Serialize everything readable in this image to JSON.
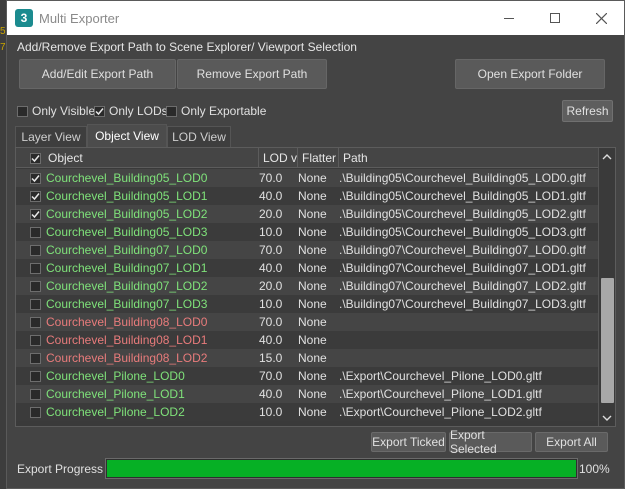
{
  "window": {
    "title": "Multi Exporter",
    "app_icon_text": "3",
    "controls": [
      "minimize-icon",
      "maximize-icon",
      "close-icon"
    ]
  },
  "section_label": "Add/Remove Export Path to Scene Explorer/ Viewport Selection",
  "buttons": {
    "add_edit": "Add/Edit Export Path",
    "remove": "Remove Export Path",
    "open_folder": "Open Export Folder"
  },
  "filters": {
    "only_visible": {
      "label": "Only Visible",
      "checked": false
    },
    "only_lods": {
      "label": "Only LODs",
      "checked": true
    },
    "only_exportable": {
      "label": "Only Exportable",
      "checked": false
    },
    "refresh": "Refresh"
  },
  "tabs": [
    {
      "label": "Layer View",
      "active": false
    },
    {
      "label": "Object View",
      "active": true
    },
    {
      "label": "LOD View",
      "active": false
    }
  ],
  "table": {
    "header_checked": true,
    "columns": {
      "object": "Object",
      "lod": "LOD va",
      "flatten": "Flatter",
      "path": "Path"
    },
    "rows": [
      {
        "checked": true,
        "name": "Courchevel_Building05_LOD0",
        "lod": "70.0",
        "flatten": "None",
        "path": ".\\Building05\\Courchevel_Building05_LOD0.gltf",
        "status": "ok"
      },
      {
        "checked": true,
        "name": "Courchevel_Building05_LOD1",
        "lod": "40.0",
        "flatten": "None",
        "path": ".\\Building05\\Courchevel_Building05_LOD1.gltf",
        "status": "ok"
      },
      {
        "checked": true,
        "name": "Courchevel_Building05_LOD2",
        "lod": "20.0",
        "flatten": "None",
        "path": ".\\Building05\\Courchevel_Building05_LOD2.gltf",
        "status": "ok"
      },
      {
        "checked": false,
        "name": "Courchevel_Building05_LOD3",
        "lod": "10.0",
        "flatten": "None",
        "path": ".\\Building05\\Courchevel_Building05_LOD3.gltf",
        "status": "ok"
      },
      {
        "checked": false,
        "name": "Courchevel_Building07_LOD0",
        "lod": "70.0",
        "flatten": "None",
        "path": ".\\Building07\\Courchevel_Building07_LOD0.gltf",
        "status": "ok"
      },
      {
        "checked": false,
        "name": "Courchevel_Building07_LOD1",
        "lod": "40.0",
        "flatten": "None",
        "path": ".\\Building07\\Courchevel_Building07_LOD1.gltf",
        "status": "ok"
      },
      {
        "checked": false,
        "name": "Courchevel_Building07_LOD2",
        "lod": "20.0",
        "flatten": "None",
        "path": ".\\Building07\\Courchevel_Building07_LOD2.gltf",
        "status": "ok"
      },
      {
        "checked": false,
        "name": "Courchevel_Building07_LOD3",
        "lod": "10.0",
        "flatten": "None",
        "path": ".\\Building07\\Courchevel_Building07_LOD3.gltf",
        "status": "ok"
      },
      {
        "checked": false,
        "name": "Courchevel_Building08_LOD0",
        "lod": "70.0",
        "flatten": "None",
        "path": "",
        "status": "missing"
      },
      {
        "checked": false,
        "name": "Courchevel_Building08_LOD1",
        "lod": "40.0",
        "flatten": "None",
        "path": "",
        "status": "missing"
      },
      {
        "checked": false,
        "name": "Courchevel_Building08_LOD2",
        "lod": "15.0",
        "flatten": "None",
        "path": "",
        "status": "missing"
      },
      {
        "checked": false,
        "name": "Courchevel_Pilone_LOD0",
        "lod": "70.0",
        "flatten": "None",
        "path": ".\\Export\\Courchevel_Pilone_LOD0.gltf",
        "status": "ok"
      },
      {
        "checked": false,
        "name": "Courchevel_Pilone_LOD1",
        "lod": "40.0",
        "flatten": "None",
        "path": ".\\Export\\Courchevel_Pilone_LOD1.gltf",
        "status": "ok"
      },
      {
        "checked": false,
        "name": "Courchevel_Pilone_LOD2",
        "lod": "10.0",
        "flatten": "None",
        "path": ".\\Export\\Courchevel_Pilone_LOD2.gltf",
        "status": "ok"
      }
    ]
  },
  "export_buttons": {
    "ticked": "Export Ticked",
    "selected": "Export Selected",
    "all": "Export All"
  },
  "progress": {
    "label": "Export Progress :",
    "value": 1.0,
    "text": "100%"
  },
  "colors": {
    "ok_name": "#7fe27a",
    "missing_name": "#e87b7b",
    "progress": "#06b025"
  }
}
